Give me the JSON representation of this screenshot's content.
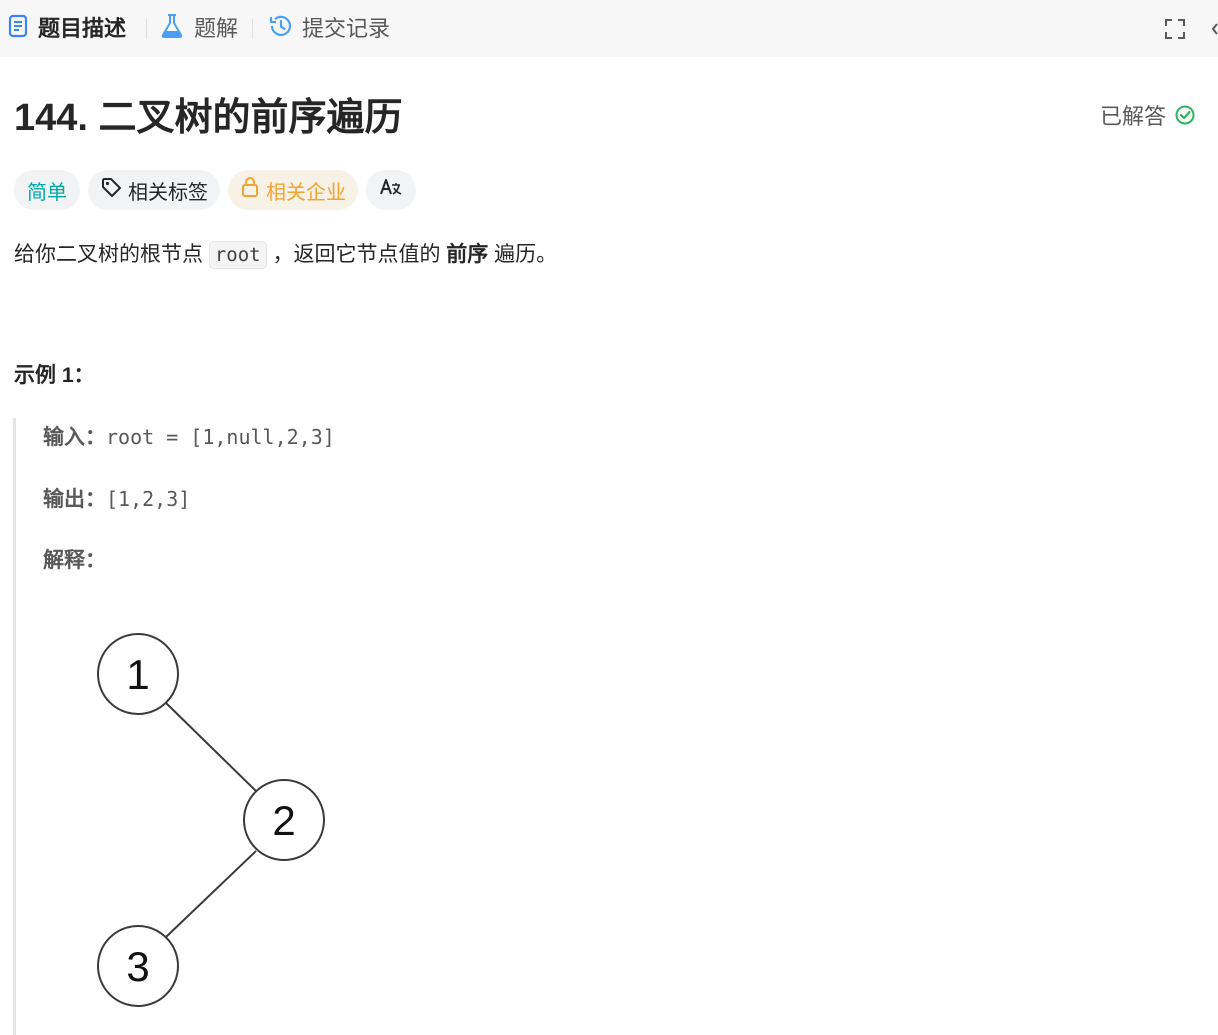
{
  "tabs": {
    "description": "题目描述",
    "solutions": "题解",
    "submissions": "提交记录"
  },
  "problem": {
    "title": "144. 二叉树的前序遍历",
    "status": "已解答"
  },
  "tags": {
    "difficulty": "简单",
    "topics": "相关标签",
    "companies": "相关企业",
    "language": "A文"
  },
  "description": {
    "part1": "给你二叉树的根节点 ",
    "code": "root",
    "part2": " ，返回它节点值的 ",
    "emphasis": "前序",
    "part3": " 遍历。"
  },
  "example1": {
    "title": "示例 1：",
    "input_label": "输入：",
    "input_value": "root = [1,null,2,3]",
    "output_label": "输出：",
    "output_value": "[1,2,3]",
    "explanation_label": "解释：",
    "tree_nodes": [
      "1",
      "2",
      "3"
    ]
  },
  "colors": {
    "accent_blue": "#3b82f6",
    "easy": "#00a9a5",
    "company": "#f0a431",
    "solved": "#2db55d"
  }
}
